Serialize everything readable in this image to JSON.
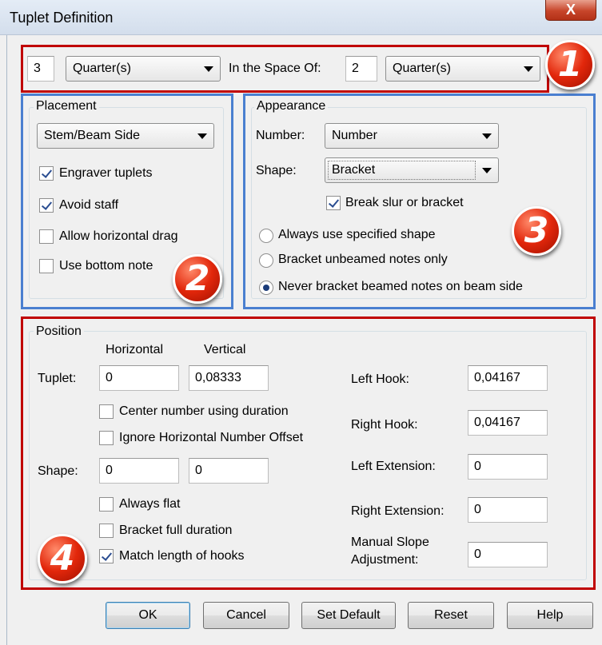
{
  "window": {
    "title": "Tuplet Definition",
    "close_label": "X"
  },
  "tuplet": {
    "count": "3",
    "unit": "Quarter(s)",
    "space_label": "In the Space Of:",
    "space_count": "2",
    "space_unit": "Quarter(s)"
  },
  "placement": {
    "group_label": "Placement",
    "side": "Stem/Beam Side",
    "checkboxes": [
      {
        "label": "Engraver tuplets",
        "checked": true
      },
      {
        "label": "Avoid staff",
        "checked": true
      },
      {
        "label": "Allow horizontal drag",
        "checked": false
      },
      {
        "label": "Use bottom note",
        "checked": false
      }
    ]
  },
  "appearance": {
    "group_label": "Appearance",
    "number_label": "Number:",
    "number_value": "Number",
    "shape_label": "Shape:",
    "shape_value": "Bracket",
    "break_label": "Break slur or bracket",
    "break_checked": true,
    "radios": [
      {
        "label": "Always use specified shape",
        "selected": false
      },
      {
        "label": "Bracket unbeamed notes only",
        "selected": false
      },
      {
        "label": "Never bracket beamed notes on beam side",
        "selected": true
      }
    ]
  },
  "position": {
    "group_label": "Position",
    "horizontal_header": "Horizontal",
    "vertical_header": "Vertical",
    "tuplet_label": "Tuplet:",
    "tuplet_h": "0",
    "tuplet_v": "0,08333",
    "center_number_label": "Center number using duration",
    "ignore_offset_label": "Ignore Horizontal Number Offset",
    "shape_label": "Shape:",
    "shape_h": "0",
    "shape_v": "0",
    "always_flat_label": "Always flat",
    "bracket_full_label": "Bracket full duration",
    "match_hooks_label": "Match length of hooks",
    "left_hook_label": "Left Hook:",
    "left_hook": "0,04167",
    "right_hook_label": "Right Hook:",
    "right_hook": "0,04167",
    "left_ext_label": "Left Extension:",
    "left_ext": "0",
    "right_ext_label": "Right Extension:",
    "right_ext": "0",
    "slope_label_1": "Manual Slope",
    "slope_label_2": "Adjustment:",
    "slope": "0"
  },
  "buttons": {
    "ok": "OK",
    "cancel": "Cancel",
    "set_default": "Set Default",
    "reset": "Reset",
    "help": "Help"
  },
  "badges": [
    "1",
    "2",
    "3",
    "4"
  ],
  "colors": {
    "callout_red": "#c00000",
    "callout_blue": "#4a7fd0"
  }
}
